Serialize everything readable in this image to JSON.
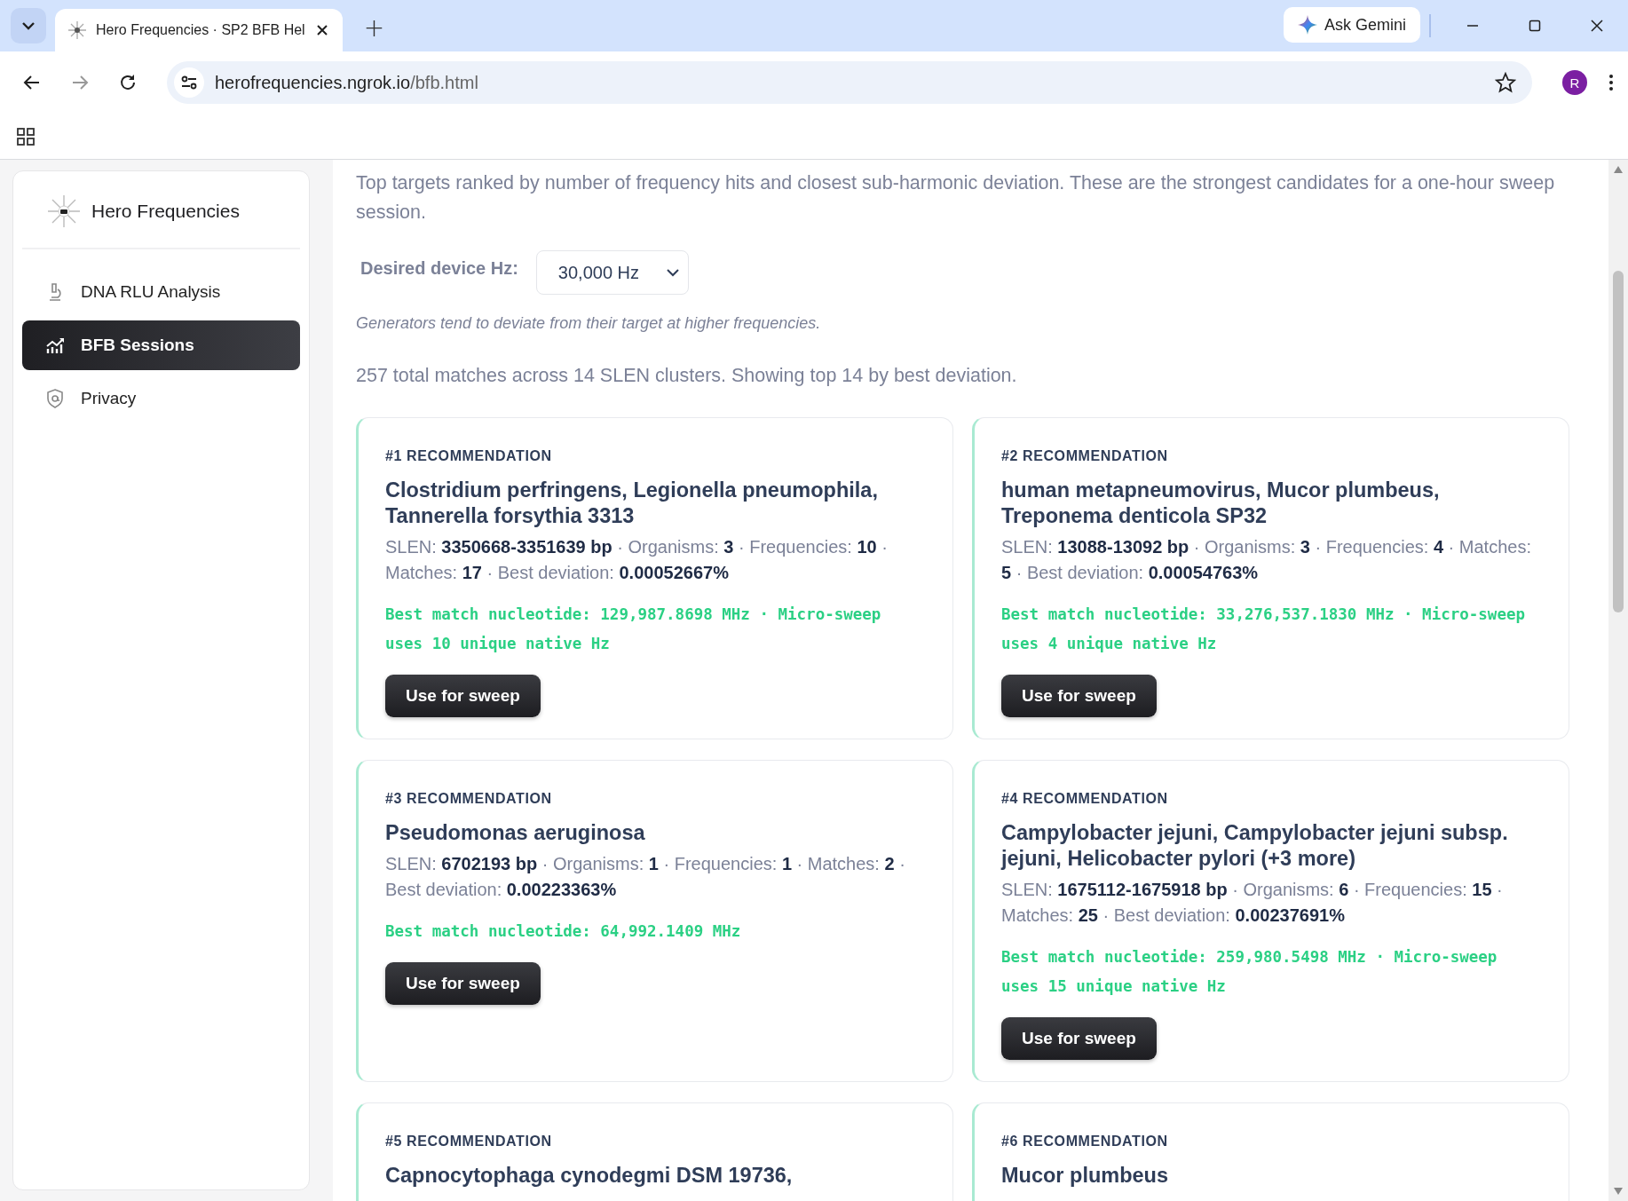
{
  "browser": {
    "tab_title": "Hero Frequencies · SP2 BFB Hel",
    "new_tab": "+",
    "gemini": "Ask Gemini",
    "url_domain": "herofrequencies.ngrok.io",
    "url_path": "/bfb.html",
    "avatar": "R"
  },
  "sidebar": {
    "brand": "Hero Frequencies",
    "items": [
      {
        "label": "DNA RLU Analysis",
        "selected": false
      },
      {
        "label": "BFB Sessions",
        "selected": true
      },
      {
        "label": "Privacy",
        "selected": false
      }
    ]
  },
  "intro": "Top targets ranked by number of frequency hits and closest sub-harmonic deviation. These are the strongest candidates for a one-hour sweep session.",
  "device": {
    "label": "Desired device Hz:",
    "value": "30,000 Hz"
  },
  "note": "Generators tend to deviate from their target at higher frequencies.",
  "summary": "257 total matches across 14 SLEN clusters. Showing top 14 by best deviation.",
  "cards": [
    {
      "rank": "#1 RECOMMENDATION",
      "title": "Clostridium perfringens, Legionella pneumophila, Tannerella forsythia 3313",
      "meta": "SLEN: **3350668-3351639 bp** · Organisms: **3** · Frequencies: **10** · Matches: **17** · Best deviation: **0.00052667%**",
      "nucleotide": "Best match nucleotide: 129,987.8698 MHz · Micro-sweep uses 10 unique native Hz",
      "button": "Use for sweep"
    },
    {
      "rank": "#2 RECOMMENDATION",
      "title": "human metapneumovirus, Mucor plumbeus, Treponema denticola SP32",
      "meta": "SLEN: **13088-13092 bp** · Organisms: **3** · Frequencies: **4** · Matches: **5** · Best deviation: **0.00054763%**",
      "nucleotide": "Best match nucleotide: 33,276,537.1830 MHz · Micro-sweep uses 4 unique native Hz",
      "button": "Use for sweep"
    },
    {
      "rank": "#3 RECOMMENDATION",
      "title": "Pseudomonas aeruginosa",
      "meta": "SLEN: **6702193 bp** · Organisms: **1** · Frequencies: **1** · Matches: **2** · Best deviation: **0.00223363%**",
      "nucleotide": "Best match nucleotide: 64,992.1409 MHz",
      "button": "Use for sweep"
    },
    {
      "rank": "#4 RECOMMENDATION",
      "title": "Campylobacter jejuni, Campylobacter jejuni subsp. jejuni, Helicobacter pylori (+3 more)",
      "meta": "SLEN: **1675112-1675918 bp** · Organisms: **6** · Frequencies: **15** · Matches: **25** · Best deviation: **0.00237691%**",
      "nucleotide": "Best match nucleotide: 259,980.5498 MHz · Micro-sweep uses 15 unique native Hz",
      "button": "Use for sweep"
    },
    {
      "rank": "#5 RECOMMENDATION",
      "title": "Capnocytophaga cynodegmi DSM 19736,"
    },
    {
      "rank": "#6 RECOMMENDATION",
      "title": "Mucor plumbeus"
    }
  ]
}
